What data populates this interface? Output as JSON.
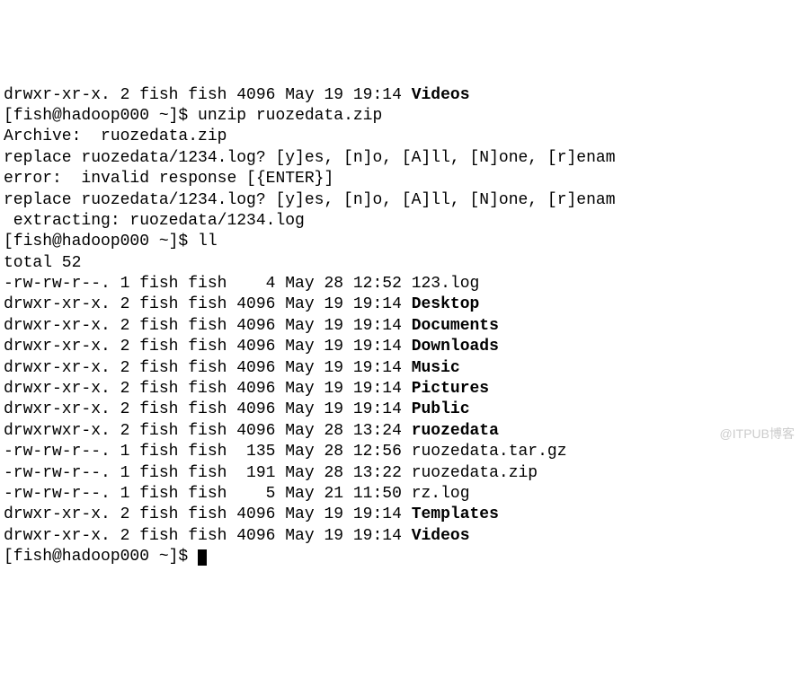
{
  "top_partial": {
    "perm": "drwxr-xr-x.",
    "links": "2",
    "owner": "fish",
    "group": "fish",
    "size": "4096",
    "date": "May 19 19:14",
    "name": "Videos"
  },
  "prompt1": {
    "user_host": "[fish@hadoop000 ~]$",
    "command": "unzip ruozedata.zip"
  },
  "archive_line": "Archive:  ruozedata.zip",
  "replace1": "replace ruozedata/1234.log? [y]es, [n]o, [A]ll, [N]one, [r]enam",
  "error_line": "error:  invalid response [{ENTER}]",
  "replace2": "replace ruozedata/1234.log? [y]es, [n]o, [A]ll, [N]one, [r]enam",
  "extracting": " extracting: ruozedata/1234.log      ",
  "prompt2": {
    "user_host": "[fish@hadoop000 ~]$",
    "command": "ll"
  },
  "total": "total 52",
  "listings": [
    {
      "perm": "-rw-rw-r--.",
      "links": "1",
      "owner": "fish",
      "group": "fish",
      "size": "   4",
      "date": "May 28 12:52",
      "name": "123.log",
      "bold": false
    },
    {
      "perm": "drwxr-xr-x.",
      "links": "2",
      "owner": "fish",
      "group": "fish",
      "size": "4096",
      "date": "May 19 19:14",
      "name": "Desktop",
      "bold": true
    },
    {
      "perm": "drwxr-xr-x.",
      "links": "2",
      "owner": "fish",
      "group": "fish",
      "size": "4096",
      "date": "May 19 19:14",
      "name": "Documents",
      "bold": true
    },
    {
      "perm": "drwxr-xr-x.",
      "links": "2",
      "owner": "fish",
      "group": "fish",
      "size": "4096",
      "date": "May 19 19:14",
      "name": "Downloads",
      "bold": true
    },
    {
      "perm": "drwxr-xr-x.",
      "links": "2",
      "owner": "fish",
      "group": "fish",
      "size": "4096",
      "date": "May 19 19:14",
      "name": "Music",
      "bold": true
    },
    {
      "perm": "drwxr-xr-x.",
      "links": "2",
      "owner": "fish",
      "group": "fish",
      "size": "4096",
      "date": "May 19 19:14",
      "name": "Pictures",
      "bold": true
    },
    {
      "perm": "drwxr-xr-x.",
      "links": "2",
      "owner": "fish",
      "group": "fish",
      "size": "4096",
      "date": "May 19 19:14",
      "name": "Public",
      "bold": true
    },
    {
      "perm": "drwxrwxr-x.",
      "links": "2",
      "owner": "fish",
      "group": "fish",
      "size": "4096",
      "date": "May 28 13:24",
      "name": "ruozedata",
      "bold": true
    },
    {
      "perm": "-rw-rw-r--.",
      "links": "1",
      "owner": "fish",
      "group": "fish",
      "size": " 135",
      "date": "May 28 12:56",
      "name": "ruozedata.tar.gz",
      "bold": false
    },
    {
      "perm": "-rw-rw-r--.",
      "links": "1",
      "owner": "fish",
      "group": "fish",
      "size": " 191",
      "date": "May 28 13:22",
      "name": "ruozedata.zip",
      "bold": false
    },
    {
      "perm": "-rw-rw-r--.",
      "links": "1",
      "owner": "fish",
      "group": "fish",
      "size": "   5",
      "date": "May 21 11:50",
      "name": "rz.log",
      "bold": false
    },
    {
      "perm": "drwxr-xr-x.",
      "links": "2",
      "owner": "fish",
      "group": "fish",
      "size": "4096",
      "date": "May 19 19:14",
      "name": "Templates",
      "bold": true
    },
    {
      "perm": "drwxr-xr-x.",
      "links": "2",
      "owner": "fish",
      "group": "fish",
      "size": "4096",
      "date": "May 19 19:14",
      "name": "Videos",
      "bold": true
    }
  ],
  "prompt3": {
    "user_host": "[fish@hadoop000 ~]$"
  },
  "watermark": "@ITPUB博客"
}
